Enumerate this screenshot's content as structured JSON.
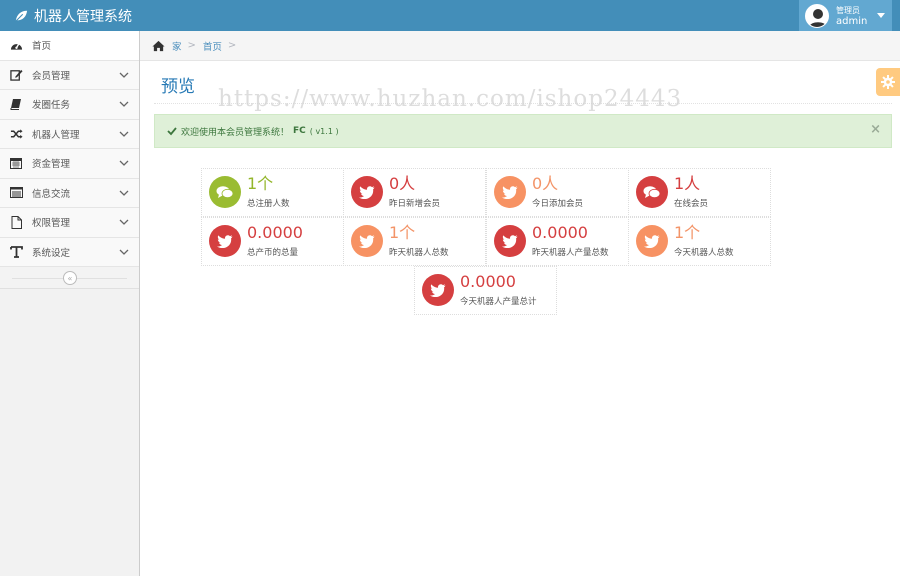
{
  "app": {
    "title": "机器人管理系统"
  },
  "user": {
    "role": "管理员",
    "name": "admin"
  },
  "sidebar": {
    "items": [
      {
        "label": "首页",
        "icon": "dashboard-icon"
      },
      {
        "label": "会员管理",
        "icon": "edit-icon"
      },
      {
        "label": "发圈任务",
        "icon": "book-icon"
      },
      {
        "label": "机器人管理",
        "icon": "random-icon"
      },
      {
        "label": "资金管理",
        "icon": "calendar-icon"
      },
      {
        "label": "信息交流",
        "icon": "list-alt-icon"
      },
      {
        "label": "权限管理",
        "icon": "file-icon"
      },
      {
        "label": "系统设定",
        "icon": "text-icon"
      }
    ],
    "collapse_glyph": "«"
  },
  "breadcrumbs": {
    "home": "家",
    "current": "首页",
    "separator": ">"
  },
  "page": {
    "title": "预览"
  },
  "watermark": "https://www.huzhan.com/ishop24443",
  "alert": {
    "message": "欢迎使用本会员管理系统！",
    "brand": "FC",
    "version": "( v1.1 )",
    "close": "×"
  },
  "stats": [
    {
      "value": "1个",
      "label": "总注册人数",
      "color": "green",
      "icon": "comments-icon"
    },
    {
      "value": "0人",
      "label": "昨日新增会员",
      "color": "red",
      "icon": "twitter-icon"
    },
    {
      "value": "0人",
      "label": "今日添加会员",
      "color": "orange",
      "icon": "twitter-icon"
    },
    {
      "value": "1人",
      "label": "在线会员",
      "color": "red",
      "icon": "comments-icon"
    },
    {
      "value": "0.0000",
      "label": "总产币的总量",
      "color": "red",
      "icon": "twitter-icon"
    },
    {
      "value": "1个",
      "label": "昨天机器人总数",
      "color": "orange",
      "icon": "twitter-icon"
    },
    {
      "value": "0.0000",
      "label": "昨天机器人产量总数",
      "color": "red",
      "icon": "twitter-icon"
    },
    {
      "value": "1个",
      "label": "今天机器人总数",
      "color": "orange",
      "icon": "twitter-icon"
    },
    {
      "value": "0.0000",
      "label": "今天机器人产量总计",
      "color": "red",
      "icon": "twitter-icon"
    }
  ],
  "colors": {
    "navbar": "#438eb9",
    "green": "#9abc32",
    "red": "#d53f40",
    "orange": "#f79263",
    "link": "#4c8fbd"
  }
}
